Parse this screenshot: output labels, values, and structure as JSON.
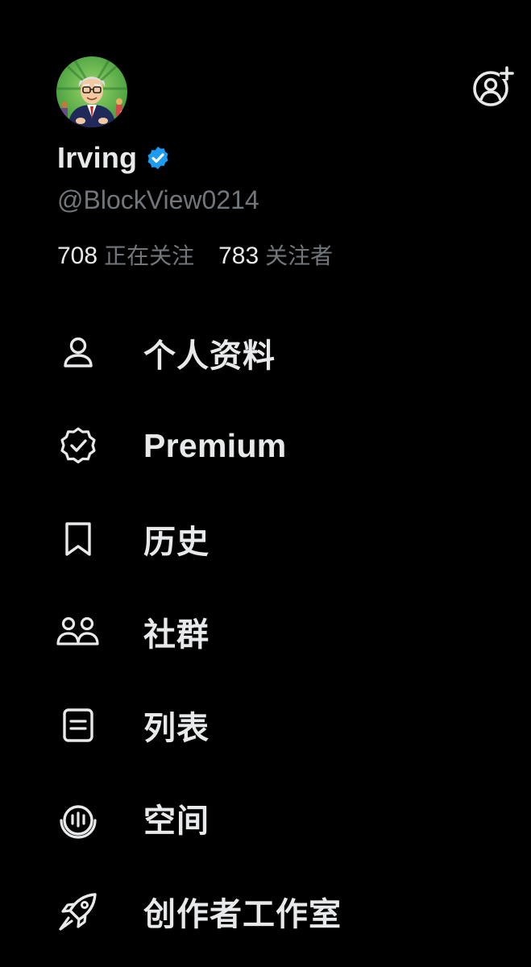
{
  "colors": {
    "background": "#000000",
    "primary_text": "#e7e9ea",
    "secondary_text": "#71767b",
    "verified_blue": "#1d9bf0",
    "avatar_background": "#4caf50"
  },
  "profile": {
    "display_name": "Irving",
    "handle": "@BlockView0214",
    "verified_icon": "verified-badge-icon",
    "avatar_icon": "avatar-icon"
  },
  "header": {
    "add_account_icon": "add-account-icon"
  },
  "stats": {
    "following_count": "708",
    "following_label": "正在关注",
    "followers_count": "783",
    "followers_label": "关注者"
  },
  "menu": {
    "items": [
      {
        "id": "profile",
        "icon": "person-icon",
        "label": "个人资料"
      },
      {
        "id": "premium",
        "icon": "premium-badge-icon",
        "label": "Premium"
      },
      {
        "id": "history",
        "icon": "bookmark-icon",
        "label": "历史"
      },
      {
        "id": "communities",
        "icon": "people-icon",
        "label": "社群"
      },
      {
        "id": "lists",
        "icon": "list-icon",
        "label": "列表"
      },
      {
        "id": "spaces",
        "icon": "spaces-icon",
        "label": "空间"
      },
      {
        "id": "creator-studio",
        "icon": "rocket-icon",
        "label": "创作者工作室"
      }
    ]
  }
}
